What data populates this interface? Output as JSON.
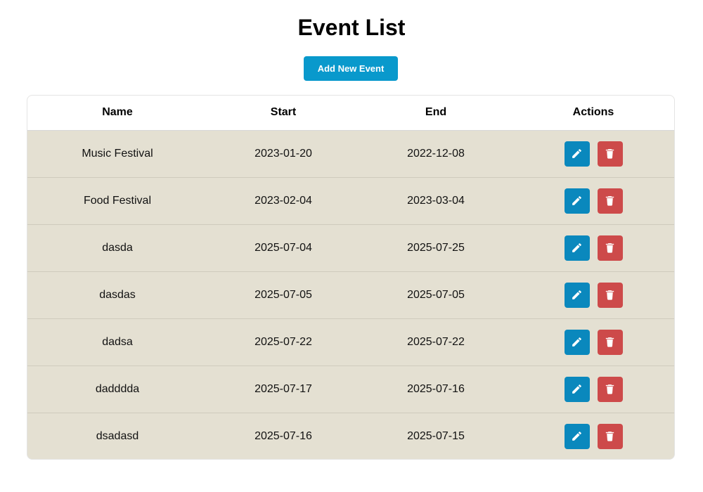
{
  "page": {
    "title": "Event List",
    "add_button_label": "Add New Event"
  },
  "table": {
    "headers": {
      "name": "Name",
      "start": "Start",
      "end": "End",
      "actions": "Actions"
    },
    "rows": [
      {
        "name": "Music Festival",
        "start": "2023-01-20",
        "end": "2022-12-08"
      },
      {
        "name": "Food Festival",
        "start": "2023-02-04",
        "end": "2023-03-04"
      },
      {
        "name": "dasda",
        "start": "2025-07-04",
        "end": "2025-07-25"
      },
      {
        "name": "dasdas",
        "start": "2025-07-05",
        "end": "2025-07-05"
      },
      {
        "name": "dadsa",
        "start": "2025-07-22",
        "end": "2025-07-22"
      },
      {
        "name": "dadddda",
        "start": "2025-07-17",
        "end": "2025-07-16"
      },
      {
        "name": "dsadasd",
        "start": "2025-07-16",
        "end": "2025-07-15"
      }
    ]
  },
  "icons": {
    "edit": "pencil-icon",
    "delete": "trash-icon"
  },
  "colors": {
    "primary": "#0999cc",
    "edit_button": "#0a88bd",
    "delete_button": "#cd4a4a",
    "row_background": "#e4e0d2",
    "header_background": "#ffffff"
  }
}
